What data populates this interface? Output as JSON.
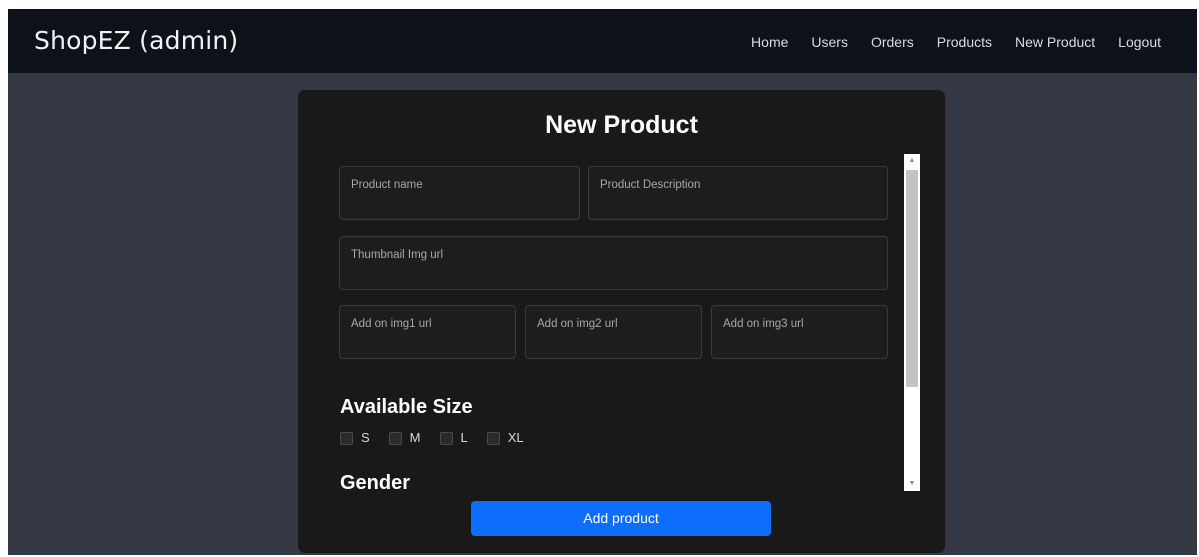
{
  "app": {
    "brand": "ShopEZ (admin)"
  },
  "nav": {
    "items": [
      {
        "label": "Home"
      },
      {
        "label": "Users"
      },
      {
        "label": "Orders"
      },
      {
        "label": "Products"
      },
      {
        "label": "New Product"
      },
      {
        "label": "Logout"
      }
    ]
  },
  "form": {
    "title": "New Product",
    "product_name_placeholder": "Product name",
    "product_description_placeholder": "Product Description",
    "thumbnail_placeholder": "Thumbnail Img url",
    "addon_img1_placeholder": "Add on img1 url",
    "addon_img2_placeholder": "Add on img2 url",
    "addon_img3_placeholder": "Add on img3 url",
    "available_size_heading": "Available Size",
    "sizes": [
      {
        "label": "S",
        "checked": false
      },
      {
        "label": "M",
        "checked": false
      },
      {
        "label": "L",
        "checked": false
      },
      {
        "label": "XL",
        "checked": false
      }
    ],
    "gender_heading": "Gender",
    "submit_label": "Add product"
  },
  "scrollbar": {
    "up_arrow": "▲",
    "down_arrow": "▼"
  },
  "colors": {
    "navbar_bg": "#0c111a",
    "page_bg": "#333844",
    "card_bg": "#191919",
    "primary_button": "#0d6efd"
  }
}
